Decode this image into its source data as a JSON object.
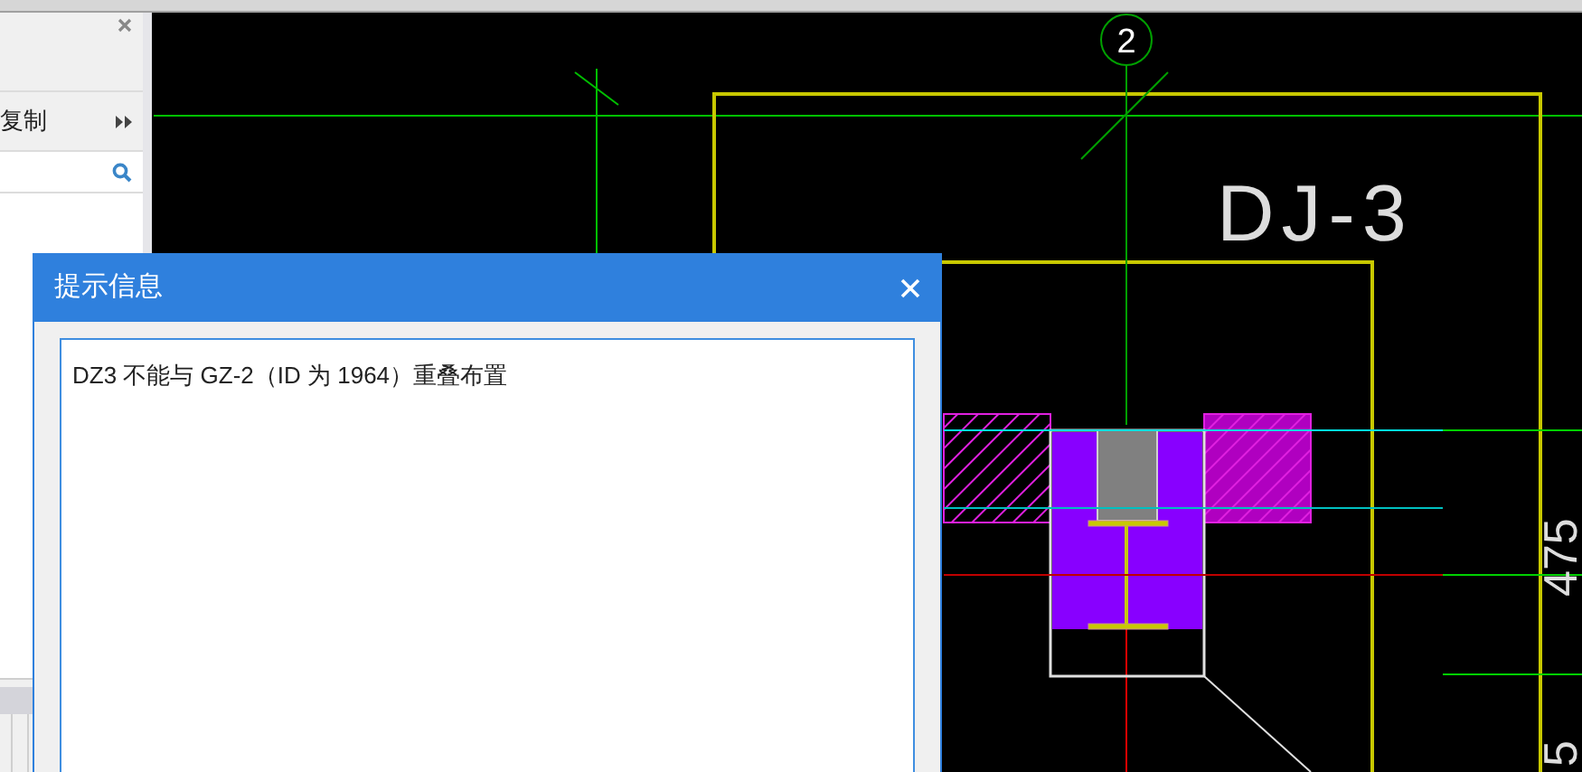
{
  "left_panel": {
    "toolbar_label": "复制"
  },
  "drawing": {
    "axis_label": "2",
    "foundation_label": "DJ-3",
    "dimension_texts": [
      "475",
      "5"
    ]
  },
  "dialog": {
    "title": "提示信息",
    "message": "DZ3 不能与 GZ-2（ID 为 1964）重叠布置"
  }
}
